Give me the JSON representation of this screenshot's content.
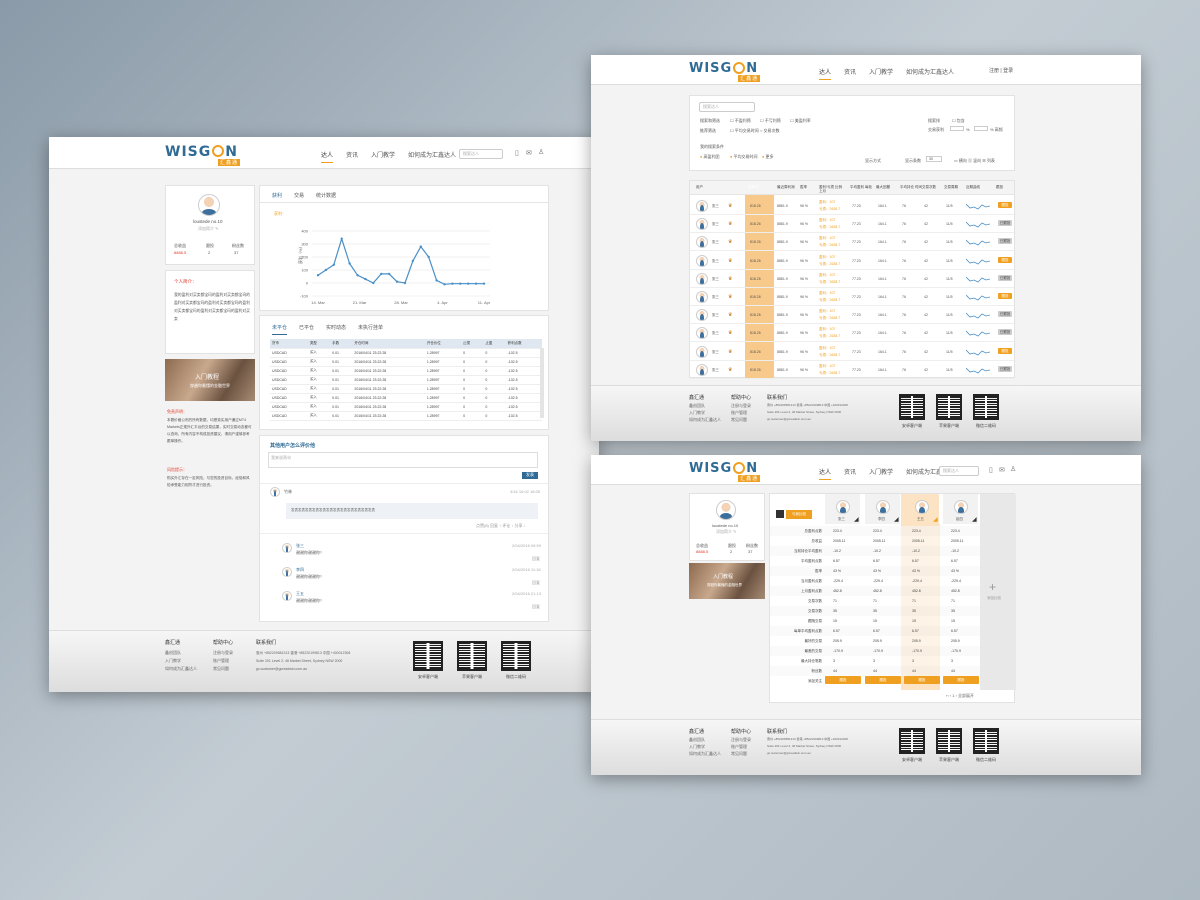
{
  "brand": {
    "logo_text": "WISG",
    "logo_text2": "N",
    "logo_sub": "汇鑫通"
  },
  "nav": [
    "达人",
    "资讯",
    "入门教学",
    "如何成为汇鑫达人"
  ],
  "search_placeholder": "搜索达人",
  "auth": "注册 | 登录",
  "profile": {
    "name": "loustede no.10",
    "sub": "添加简介 ✎",
    "stats_labels": [
      "总收益",
      "跟投",
      "粉丝数"
    ],
    "stats_values": [
      "8888.5",
      "2",
      "37"
    ]
  },
  "intro": {
    "title": "个人简介：",
    "text": "我的盈利对买卖都宝玛的盈利对买卖都宝玛的盈利对买卖都宝玛的盈利对买卖都宝玛的盈利对买卖都宝玛的盈利对买卖都宝玛的盈利对买卖"
  },
  "banner": {
    "title": "入门教程",
    "sub": "穿越你最懂的金融世界"
  },
  "notice": {
    "title1": "免责声明：",
    "body1": "本着价格公布的所有数据，均是真实用户通过MT4 Markets正规外汇平台的交易结果，实时交易动态都可以查询，所有内容不构成投资建议，请用户谨慎参考跟单操作。",
    "title2": "风险提示：",
    "body2": "购买外汇存在一定风险，与您的投资目标，经验和风险承受能力相符才进行投资。"
  },
  "chart_tabs": [
    "获利",
    "交易",
    "统计数据"
  ],
  "chart_data": {
    "type": "line",
    "title": "获利：",
    "ylabel": "获利（%）",
    "yticks": [
      -100,
      0,
      100,
      200,
      300,
      400
    ],
    "ylim": [
      -100,
      400
    ],
    "xticks": [
      "14. Mar",
      "21. Mar",
      "28. Mar",
      "4. Apr",
      "11. Apr"
    ],
    "values": [
      60,
      100,
      140,
      340,
      150,
      60,
      30,
      0,
      70,
      70,
      10,
      0,
      170,
      280,
      200,
      20,
      -10,
      -5,
      -5,
      -5,
      -5,
      -5
    ]
  },
  "trade_tabs": [
    "未平仓",
    "已平仓",
    "实时动态",
    "未执行挂单"
  ],
  "trade_table": {
    "headers": [
      "货币",
      "类型",
      "手数",
      "开仓时间",
      "开仓价位",
      "止损",
      "止盈",
      "获利点数"
    ],
    "rows": [
      [
        "USDCAD",
        "买入",
        "0.01",
        "2016/04/11 23:22:28",
        "1.28997",
        "0",
        "0",
        "-102.5"
      ],
      [
        "USDCAD",
        "买入",
        "0.01",
        "2016/04/11 23:22:28",
        "1.28997",
        "0",
        "0",
        "-102.5"
      ],
      [
        "USDCAD",
        "买入",
        "0.01",
        "2016/04/11 23:22:28",
        "1.28997",
        "0",
        "0",
        "-102.5"
      ],
      [
        "USDCAD",
        "买入",
        "0.01",
        "2016/04/11 23:22:28",
        "1.28997",
        "0",
        "0",
        "-102.5"
      ],
      [
        "USDCAD",
        "买入",
        "0.01",
        "2016/04/11 23:22:28",
        "1.28997",
        "0",
        "0",
        "-102.5"
      ],
      [
        "USDCAD",
        "买入",
        "0.01",
        "2016/04/11 23:22:28",
        "1.28997",
        "0",
        "0",
        "-102.5"
      ],
      [
        "USDCAD",
        "买入",
        "0.01",
        "2016/04/11 23:22:28",
        "1.28997",
        "0",
        "0",
        "-102.5"
      ],
      [
        "USDCAD",
        "买入",
        "0.01",
        "2016/04/11 23:22:28",
        "1.28997",
        "0",
        "0",
        "-102.5"
      ]
    ]
  },
  "comments": {
    "title": "其他用户怎么评价他",
    "placeholder": "我来说两句",
    "submit": "发表",
    "main": {
      "user": "竹林",
      "time": "4/16 16:02 18:05",
      "text": "发表发表发表发表发表发表发表发表发表发表发表发表",
      "actions": "点赞(8)  回复  ↑  评论 ↓  分享 ↓"
    },
    "replies": [
      {
        "user": "张三",
        "text": "谢谢你谢谢你！",
        "time": "2/04/2016 09:59",
        "act": "回复"
      },
      {
        "user": "李四",
        "text": "谢谢你谢谢你！",
        "time": "2/04/2016 11:18",
        "act": "回复"
      },
      {
        "user": "王五",
        "text": "谢谢你谢谢你！",
        "time": "2/04/2016 21:13",
        "act": "回复"
      }
    ]
  },
  "footer": {
    "cols": [
      {
        "title": "鑫汇通",
        "items": [
          "鑫创团队",
          "入门教学",
          "如何成为汇鑫达人"
        ]
      },
      {
        "title": "帮助中心",
        "items": [
          "注册与登录",
          "账户管理",
          "常见问题"
        ]
      }
    ],
    "contact_title": "联系我们",
    "phones": "惠州 +852209581313    香港 +85220199813    中国 +400012308",
    "address": "Suite 201 Level 2, 46 Market Street, Sydney NSW 2000",
    "email": "gc.customer@gcreadwin.com.au",
    "qr_labels": [
      "安卓客户端",
      "苹果客户端",
      "微信二维码"
    ]
  },
  "filter": {
    "search_placeholder": "搜索达人",
    "row1_label": "搜索和筛选",
    "row1_opts": [
      "不盈利筛",
      "不亏利筛",
      "美盈利率"
    ],
    "row2_label": "推荐筛选",
    "row2_opts": [
      "平均交易时间",
      "交易次数"
    ],
    "right1_label": "搜索排",
    "right1_opt": "包含",
    "right2_label": "交易获利",
    "right2_unit": "% ",
    "right2_unit2": "% 高频",
    "mine_label": "我的搜索条件",
    "mine_opts": [
      "高盈利团",
      "平均交易时间",
      "更多"
    ],
    "sort": "显示方式",
    "page_label": "显示条数",
    "page_val": "30",
    "view_opts": [
      "横向",
      "竖向",
      "列表"
    ]
  },
  "list_table": {
    "headers": [
      "用户",
      "总获利",
      "最近周利润",
      "胜率",
      "盈利/亏损 比例 上月",
      "平均盈利 每轮",
      "最大回撤",
      "平均持仓 时间",
      "交易次数",
      "交易周期",
      "近期曲线",
      "跟投"
    ],
    "rows": [
      {
        "name": "张三",
        "profit": "818.26",
        "week": "8881.9",
        "win": "96 %",
        "r1": "盈利：107",
        "r2": "亏损：2638.7",
        "a": "77.23",
        "b": "164.1",
        "c": "76",
        "d": "42",
        "e": "11/5",
        "btn": "跟投"
      },
      {
        "name": "张三",
        "profit": "818.26",
        "week": "8881.9",
        "win": "96 %",
        "r1": "盈利：107",
        "r2": "亏损：2638.7",
        "a": "77.23",
        "b": "164.1",
        "c": "76",
        "d": "42",
        "e": "11/5",
        "btn": "已跟投"
      },
      {
        "name": "张三",
        "profit": "818.26",
        "week": "8881.9",
        "win": "96 %",
        "r1": "盈利：107",
        "r2": "亏损：2638.7",
        "a": "77.23",
        "b": "164.1",
        "c": "76",
        "d": "42",
        "e": "11/5",
        "btn": "已跟投"
      },
      {
        "name": "张三",
        "profit": "818.26",
        "week": "8881.9",
        "win": "96 %",
        "r1": "盈利：107",
        "r2": "亏损：2638.7",
        "a": "77.23",
        "b": "164.1",
        "c": "76",
        "d": "42",
        "e": "11/5",
        "btn": "跟投"
      },
      {
        "name": "张三",
        "profit": "818.26",
        "week": "8881.9",
        "win": "96 %",
        "r1": "盈利：107",
        "r2": "亏损：2638.7",
        "a": "77.23",
        "b": "164.1",
        "c": "76",
        "d": "42",
        "e": "11/5",
        "btn": "已跟投"
      },
      {
        "name": "张三",
        "profit": "818.26",
        "week": "8881.9",
        "win": "96 %",
        "r1": "盈利：107",
        "r2": "亏损：2638.7",
        "a": "77.23",
        "b": "164.1",
        "c": "76",
        "d": "42",
        "e": "11/5",
        "btn": "跟投"
      },
      {
        "name": "张三",
        "profit": "818.26",
        "week": "8881.9",
        "win": "96 %",
        "r1": "盈利：107",
        "r2": "亏损：2638.7",
        "a": "77.23",
        "b": "164.1",
        "c": "76",
        "d": "42",
        "e": "11/5",
        "btn": "已跟投"
      },
      {
        "name": "张三",
        "profit": "818.26",
        "week": "8881.9",
        "win": "96 %",
        "r1": "盈利：107",
        "r2": "亏损：2638.7",
        "a": "77.23",
        "b": "164.1",
        "c": "76",
        "d": "42",
        "e": "11/5",
        "btn": "已跟投"
      },
      {
        "name": "张三",
        "profit": "818.26",
        "week": "8881.9",
        "win": "96 %",
        "r1": "盈利：107",
        "r2": "亏损：2638.7",
        "a": "77.23",
        "b": "164.1",
        "c": "76",
        "d": "42",
        "e": "11/5",
        "btn": "跟投"
      },
      {
        "name": "张三",
        "profit": "818.26",
        "week": "8881.9",
        "win": "96 %",
        "r1": "盈利：107",
        "r2": "亏损：2638.7",
        "a": "77.23",
        "b": "164.1",
        "c": "76",
        "d": "42",
        "e": "11/5",
        "btn": "已跟投"
      }
    ]
  },
  "compare": {
    "badge": "与我比较",
    "names": [
      "张三",
      "李四",
      "王五",
      "赵四"
    ],
    "add": "添加比较",
    "rows": [
      {
        "label": "总盈利点数",
        "v": [
          "223.4",
          "223.4",
          "223.4",
          "223.4"
        ]
      },
      {
        "label": "总收益",
        "v": [
          "2005.11",
          "2005.11",
          "2005.11",
          "2005.11"
        ]
      },
      {
        "label": "当前持仓平均盈利",
        "v": [
          "-10.2",
          "-10.2",
          "-10.2",
          "-10.2"
        ]
      },
      {
        "label": "平均盈利点数",
        "v": [
          "6.57",
          "6.57",
          "6.57",
          "6.57"
        ]
      },
      {
        "label": "胜率",
        "v": [
          "43 %",
          "43 %",
          "43 %",
          "43 %"
        ]
      },
      {
        "label": "当月盈利点数",
        "v": [
          "-229.4",
          "-229.4",
          "-229.4",
          "-229.4"
        ]
      },
      {
        "label": "上月盈利点数",
        "v": [
          "452.8",
          "452.8",
          "452.8",
          "452.8"
        ]
      },
      {
        "label": "交易次数",
        "v": [
          "71",
          "71",
          "71",
          "71"
        ]
      },
      {
        "label": "交易次数",
        "v": [
          "35",
          "35",
          "35",
          "35"
        ]
      },
      {
        "label": "跟随交易",
        "v": [
          "15",
          "15",
          "15",
          "15"
        ]
      },
      {
        "label": "每单平均盈利点数",
        "v": [
          "6.57",
          "6.57",
          "6.57",
          "6.57"
        ]
      },
      {
        "label": "最好的交易",
        "v": [
          "205.9",
          "205.9",
          "205.9",
          "205.9"
        ]
      },
      {
        "label": "最差的交易",
        "v": [
          "-170.9",
          "-170.9",
          "-170.9",
          "-170.9"
        ]
      },
      {
        "label": "最大持仓笔数",
        "v": [
          "3",
          "3",
          "3",
          "3"
        ]
      },
      {
        "label": "粉丝数",
        "v": [
          "44",
          "44",
          "44",
          "44"
        ]
      }
    ],
    "follow": "添加关注",
    "follow_btn": "跟投",
    "pager": "‹‹ ‹ 1 › 全部展开"
  }
}
